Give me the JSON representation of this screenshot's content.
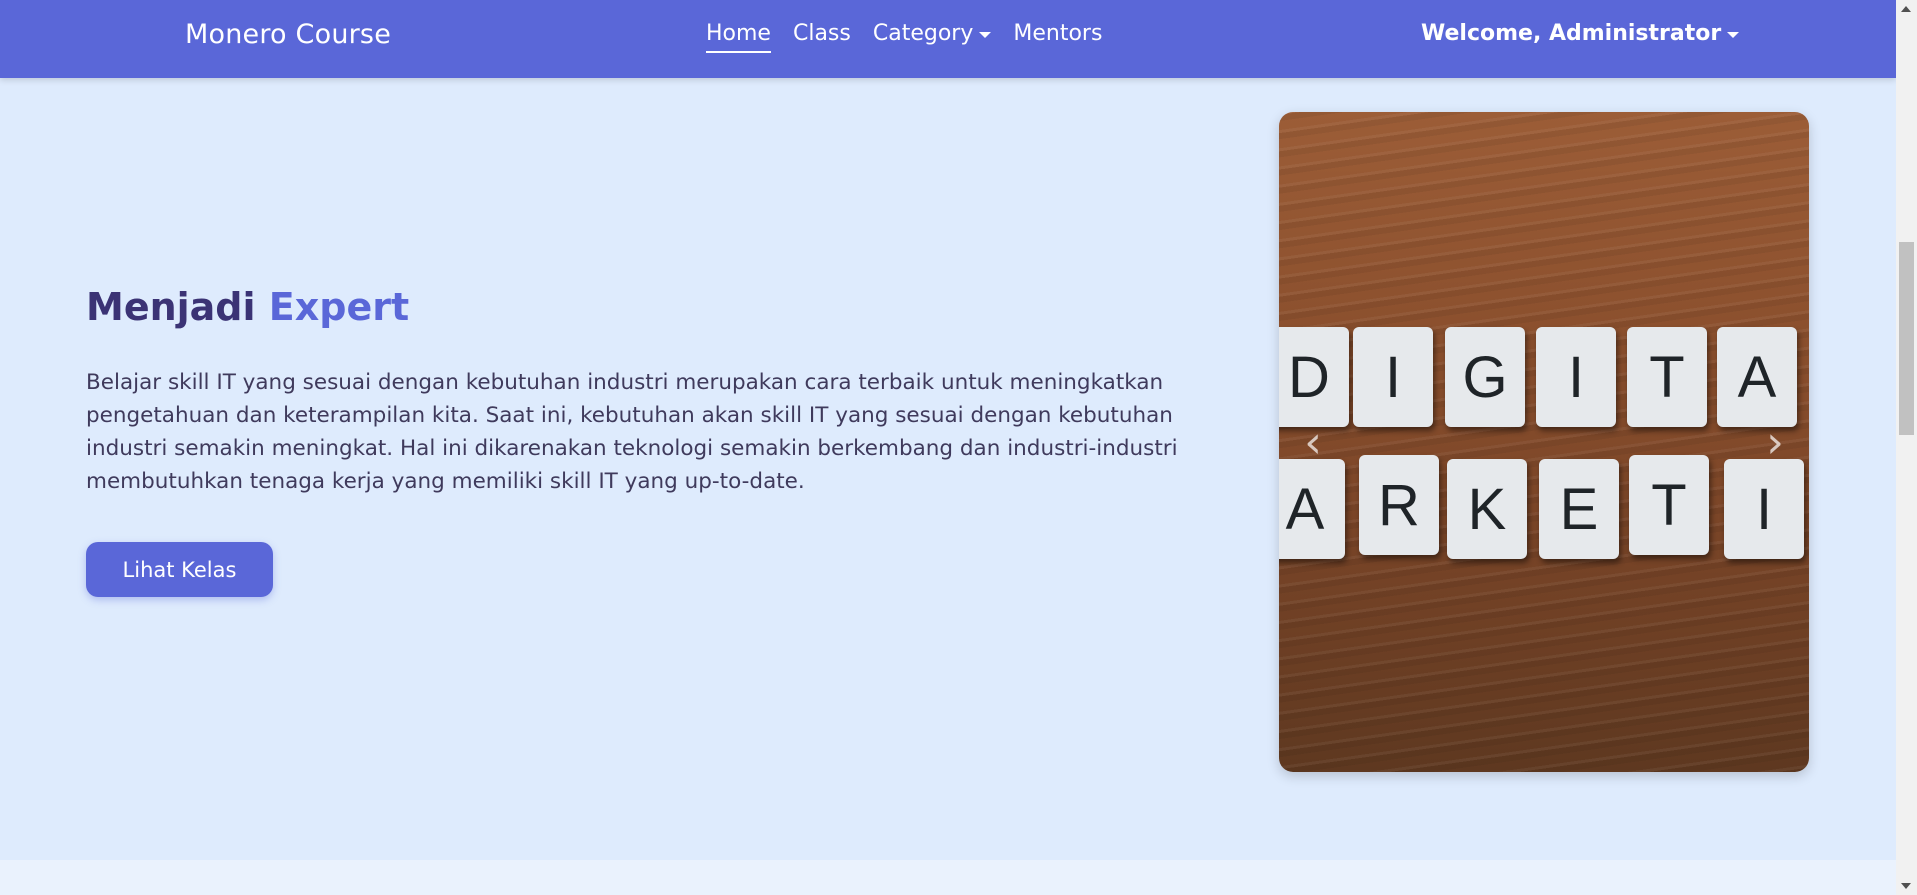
{
  "navbar": {
    "brand": "Monero Course",
    "links": [
      {
        "label": "Home",
        "active": true
      },
      {
        "label": "Class",
        "active": false
      },
      {
        "label": "Category",
        "dropdown": true
      },
      {
        "label": "Mentors",
        "active": false
      }
    ],
    "welcome": "Welcome, Administrator"
  },
  "hero": {
    "title_part1": "Menjadi",
    "title_part2": "Expert",
    "description": "Belajar skill IT yang sesuai dengan kebutuhan industri merupakan cara terbaik untuk meningkatkan pengetahuan dan keterampilan kita. Saat ini, kebutuhan akan skill IT yang sesuai dengan kebutuhan industri semakin meningkat. Hal ini dikarenakan teknologi semakin berkembang dan industri-industri membutuhkan tenaga kerja yang memiliki skill IT yang up-to-date.",
    "cta": "Lihat Kelas"
  },
  "carousel": {
    "image": {
      "row1_letters": [
        "D",
        "I",
        "G",
        "I",
        "T",
        "A"
      ],
      "row2_letters": [
        "A",
        "R",
        "K",
        "E",
        "T",
        "I"
      ]
    },
    "prev_icon": "chevron-left-icon",
    "next_icon": "chevron-right-icon"
  },
  "colors": {
    "navbar": "#5a67d8",
    "page_bg": "#deebfd",
    "title_dark": "#3b3375",
    "accent": "#5a67d8",
    "button": "#5a67d8"
  }
}
